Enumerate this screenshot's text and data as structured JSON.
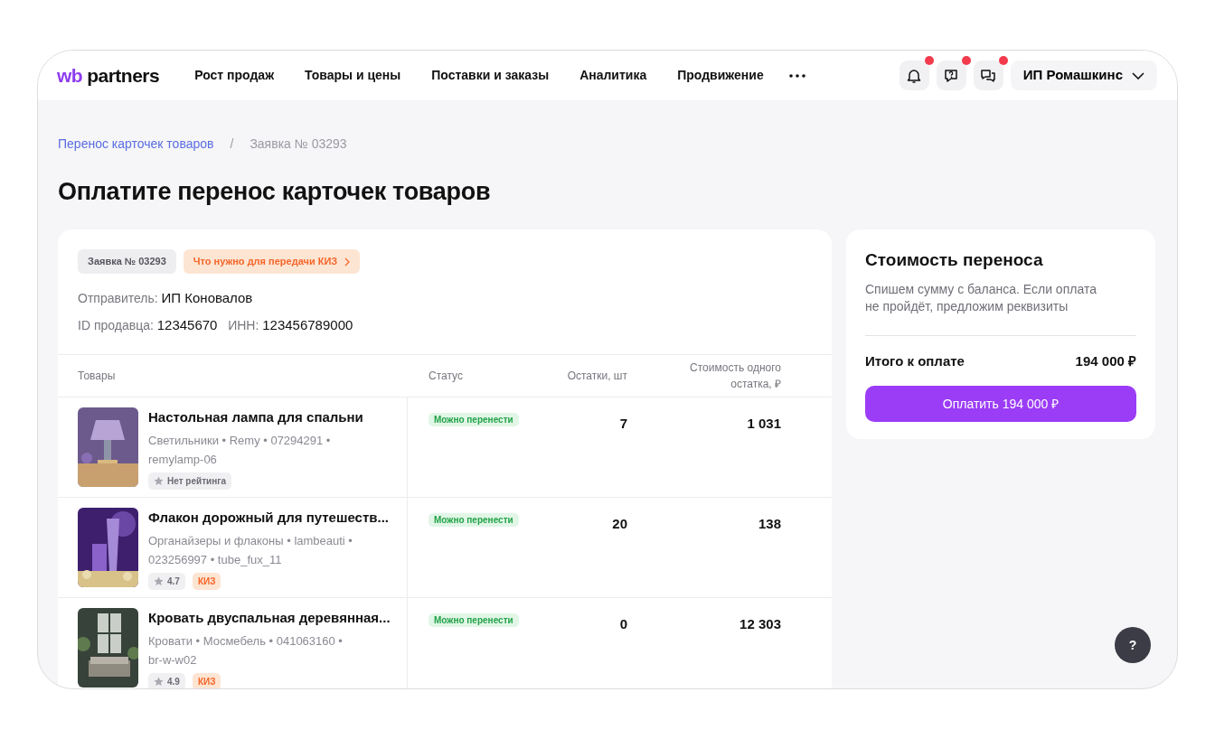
{
  "header": {
    "logo": {
      "mark": "wb",
      "name": "partners"
    },
    "nav": [
      "Рост продаж",
      "Товары и цены",
      "Поставки и заказы",
      "Аналитика",
      "Продвижение"
    ],
    "icons": [
      {
        "kind": "bell",
        "dot": true
      },
      {
        "kind": "help",
        "dot": true
      },
      {
        "kind": "chat",
        "dot": true
      }
    ],
    "account": "ИП Ромашкинс"
  },
  "breadcrumbs": [
    {
      "label": "Перенос карточек товаров",
      "current": false
    },
    {
      "label": "Заявка № 03293",
      "current": true,
      "separator": "/"
    }
  ],
  "title": "Оплатите перенос карточек товаров",
  "request": {
    "number": "Заявка № 03293",
    "kiz_link": "Что нужно для передачи КИЗ",
    "sender_label": "Отправитель:",
    "sender": "ИП Коновалов",
    "seller_id_label": "ID продавца:",
    "seller_id": "12345670",
    "inn_label": "ИНН:",
    "inn": "123456789000"
  },
  "table": {
    "columns": [
      "Товары",
      "Статус",
      "Остатки, шт",
      "Стоимость одного остатка, ₽"
    ],
    "rows": [
      {
        "name": "Настольная лампа для спальни",
        "meta": "Светильники • Remy • 07294291 • remylamp-06",
        "rating": "Нет рейтинга",
        "kiz": null,
        "status": "Можно перенести",
        "stock": "7",
        "price": "1 031"
      },
      {
        "name": "Флакон дорожный для путешеств...",
        "meta": "Органайзеры и флаконы • lambeauti • 023256997 • tube_fux_11",
        "rating": "4.7",
        "kiz": "КИЗ",
        "status": "Можно перенести",
        "stock": "20",
        "price": "138"
      },
      {
        "name": "Кровать двуспальная деревянная...",
        "meta": "Кровати • Мосмебель • 041063160 • br-w-w02",
        "rating": "4.9",
        "kiz": "КИЗ",
        "status": "Можно перенести",
        "stock": "0",
        "price": "12 303"
      }
    ]
  },
  "summary": {
    "title": "Стоимость переноса",
    "description": "Спишем сумму с баланса. Если оплата не пройдёт, предложим реквизиты",
    "total_label": "Итого к оплате",
    "total": "194 000 ₽",
    "pay_button": "Оплатить 194 000 ₽"
  },
  "help_button": "?"
}
